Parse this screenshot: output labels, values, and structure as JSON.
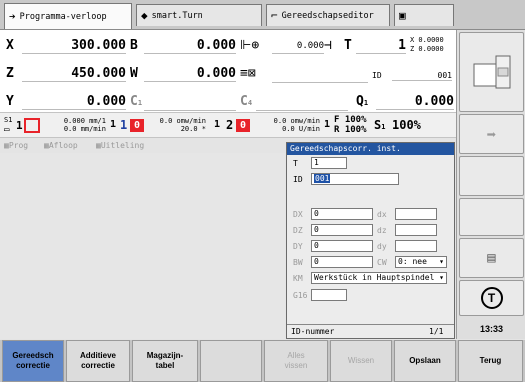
{
  "tabs": [
    {
      "icon": "➔",
      "label": "Programma-verloop"
    },
    {
      "icon": "◆",
      "label": "smart.Turn"
    },
    {
      "icon": "⌐",
      "label": "Gereedschapseditor"
    },
    {
      "icon": "▣",
      "label": ""
    }
  ],
  "dro": {
    "X": {
      "axis": "X",
      "value": "300.000"
    },
    "B": {
      "axis": "B",
      "value": "0.000"
    },
    "B2val": "0.000",
    "T": {
      "axis": "T",
      "value": "1"
    },
    "T_x": "X  0.0000",
    "T_z": "Z  0.0000",
    "Z": {
      "axis": "Z",
      "value": "450.000"
    },
    "W": {
      "axis": "W",
      "value": "0.000"
    },
    "ID_label": "ID",
    "ID_value": "001",
    "Y": {
      "axis": "Y",
      "value": "0.000"
    },
    "C1": {
      "axis": "C",
      "sub": "1"
    },
    "C4": {
      "axis": "C",
      "sub": "4"
    },
    "Q1": {
      "axis": "Q",
      "sub": "1",
      "value": "0.000"
    }
  },
  "status": {
    "s1_label": "S1",
    "s1_num": "1",
    "feed1_a": "0.000 mm/1",
    "feed1_b": "0.0 mm/min",
    "ch1_num": "1",
    "ch1_code": "1",
    "ch1_box": "0",
    "feed2_a": "0.0 omw/min",
    "feed2_b": "20.0 *",
    "ch2_num": "1",
    "ch2_code": "2",
    "ch2_box": "0",
    "feed3_a": "0.0 omw/min",
    "feed3_b": "0.0 U/min",
    "ch3_num": "1",
    "f_label": "F 100%",
    "r_label": "R 100%",
    "s_label": "S",
    "s_sub": "1",
    "s_pct": "100%"
  },
  "subtabs": [
    "Prog",
    "Afloop",
    "Uitleling"
  ],
  "dialog": {
    "title": "Gereedschapscorr. inst.",
    "T_label": "T",
    "T_value": "1",
    "ID_label": "ID",
    "ID_value": "001",
    "DX_label": "DX",
    "DX_value": "0",
    "dx_label": "dx",
    "dx_value": "",
    "DZ_label": "DZ",
    "DZ_value": "0",
    "dz_label": "dz",
    "dz_value": "",
    "DY_label": "DY",
    "DY_value": "0",
    "dy_label": "dy",
    "dy_value": "",
    "BW_label": "BW",
    "BW_value": "0",
    "CW_label": "CW",
    "CW_value": "0: nee",
    "KM_label": "KM",
    "KM_value": "Werkstück in Hauptspindel",
    "G16_label": "G16",
    "G16_value": "",
    "footer_label": "ID-nummer",
    "footer_page": "1/1"
  },
  "right_panel": {
    "time": "13:33"
  },
  "softkeys": [
    {
      "label": "Gereedsch\ncorrectie",
      "active": true
    },
    {
      "label": "Additieve\ncorrectie",
      "active": false
    },
    {
      "label": "Magazijn-\ntabel",
      "active": false
    },
    {
      "label": "",
      "active": false
    },
    {
      "label": "Alles\nvissen",
      "active": false,
      "disabled": true
    },
    {
      "label": "Wissen",
      "active": false,
      "disabled": true
    },
    {
      "label": "Opslaan",
      "active": false
    },
    {
      "label": "Terug",
      "active": false
    }
  ]
}
